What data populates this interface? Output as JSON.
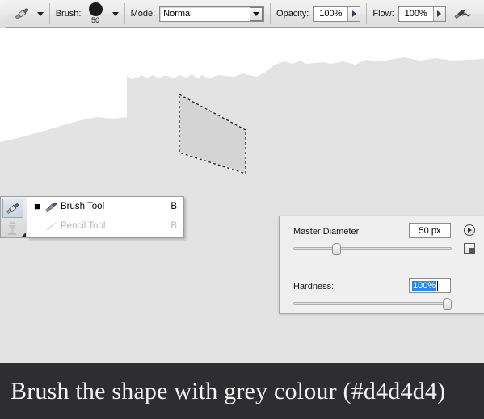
{
  "options_bar": {
    "tool_icon": "paintbrush-icon",
    "tool_preset_chevron": "chevron-down-icon",
    "brush_label": "Brush:",
    "brush_size_value": "50",
    "brush_preview_icon": "filled-circle-brush-tip",
    "brush_chevron": "chevron-down-icon",
    "mode_label": "Mode:",
    "mode_value": "Normal",
    "mode_options": [
      "Normal"
    ],
    "mode_arrow_icon": "triangle-down-icon",
    "opacity_label": "Opacity:",
    "opacity_value": "100%",
    "opacity_spin_icon": "triangle-right-icon",
    "flow_label": "Flow:",
    "flow_value": "100%",
    "flow_spin_icon": "triangle-right-icon",
    "airbrush_icon": "airbrush-icon"
  },
  "tool_flyout": {
    "launcher_icon": "paintbrush-icon",
    "launcher_ghost_icon": "clone-stamp-icon",
    "items": [
      {
        "bullet": "■",
        "icon": "paintbrush-icon",
        "label": "Brush Tool",
        "shortcut": "B",
        "state": "active"
      },
      {
        "bullet": "",
        "icon": "pencil-icon",
        "label": "Pencil Tool",
        "shortcut": "B",
        "state": "dimmed"
      }
    ]
  },
  "brush_panel": {
    "master_diameter_label": "Master Diameter",
    "master_diameter_value": "50 px",
    "master_diameter_percent": 26,
    "hardness_label": "Hardness:",
    "hardness_value": "100%",
    "hardness_percent": 100,
    "hardness_selected": true,
    "play_button_icon": "play-circle-icon",
    "panel_menu_icon": "panel-menu-icon"
  },
  "canvas": {
    "background_color": "#e3e3e3",
    "white_shape_color": "#ffffff",
    "selection_fill_color": "#d4d4d4",
    "selection_name": "marching-ants-quad-selection"
  },
  "caption": {
    "text": "Brush the shape with grey colour (#d4d4d4)",
    "background_color": "#2e2e30",
    "text_color": "#f2f2f2",
    "mentioned_color": "#d4d4d4"
  }
}
